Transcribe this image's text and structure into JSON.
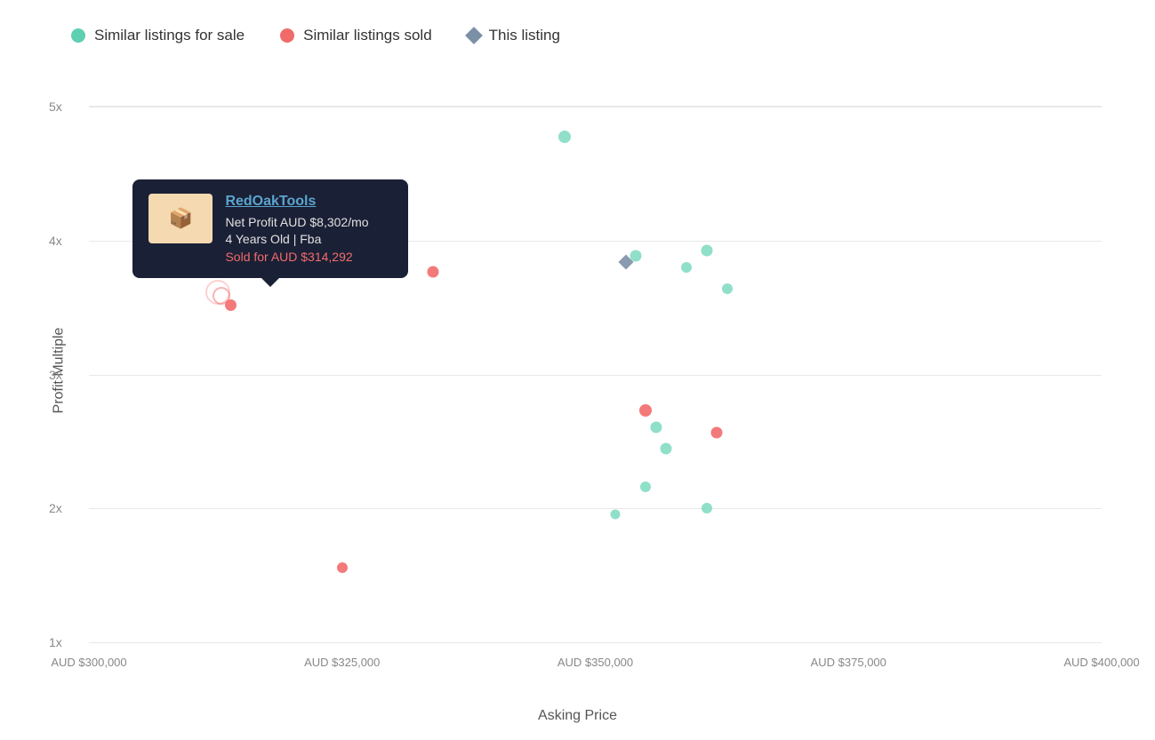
{
  "legend": {
    "items": [
      {
        "id": "for-sale",
        "label": "Similar listings for sale",
        "type": "green-dot"
      },
      {
        "id": "sold",
        "label": "Similar listings sold",
        "type": "red-dot"
      },
      {
        "id": "this",
        "label": "This listing",
        "type": "diamond"
      }
    ]
  },
  "axes": {
    "y_label": "Profit Multiple",
    "x_label": "Asking Price",
    "y_ticks": [
      "1x",
      "2x",
      "3x",
      "4x",
      "5x"
    ],
    "x_ticks": [
      "AUD $300,000",
      "AUD $325,000",
      "AUD $350,000",
      "AUD $375,000",
      "AUD $400,000"
    ]
  },
  "tooltip": {
    "title": "RedOakTools",
    "net_profit": "Net Profit AUD $8,302/mo",
    "age": "4 Years Old | Fba",
    "sold_text": "Sold for AUD $314,292",
    "icon": "📦"
  },
  "scatter": {
    "green_dots": [
      {
        "x_pct": 47,
        "y_pct": 8,
        "size": 14
      },
      {
        "x_pct": 55,
        "y_pct": 30,
        "size": 13
      },
      {
        "x_pct": 60,
        "y_pct": 29,
        "size": 12
      },
      {
        "x_pct": 62,
        "y_pct": 32,
        "size": 13
      },
      {
        "x_pct": 62,
        "y_pct": 36,
        "size": 12
      },
      {
        "x_pct": 57,
        "y_pct": 62,
        "size": 13
      },
      {
        "x_pct": 57,
        "y_pct": 66,
        "size": 13
      },
      {
        "x_pct": 57,
        "y_pct": 73,
        "size": 12
      },
      {
        "x_pct": 55,
        "y_pct": 80,
        "size": 11
      },
      {
        "x_pct": 62,
        "y_pct": 78,
        "size": 12
      }
    ],
    "red_dots": [
      {
        "x_pct": 23,
        "y_pct": 38,
        "size": 14,
        "hovered": true
      },
      {
        "x_pct": 36,
        "y_pct": 33,
        "size": 13
      },
      {
        "x_pct": 57,
        "y_pct": 59,
        "size": 14
      },
      {
        "x_pct": 63,
        "y_pct": 63,
        "size": 13
      },
      {
        "x_pct": 30,
        "y_pct": 88,
        "size": 12
      }
    ],
    "diamond": {
      "x_pct": 55,
      "y_pct": 31,
      "size": 12
    }
  }
}
